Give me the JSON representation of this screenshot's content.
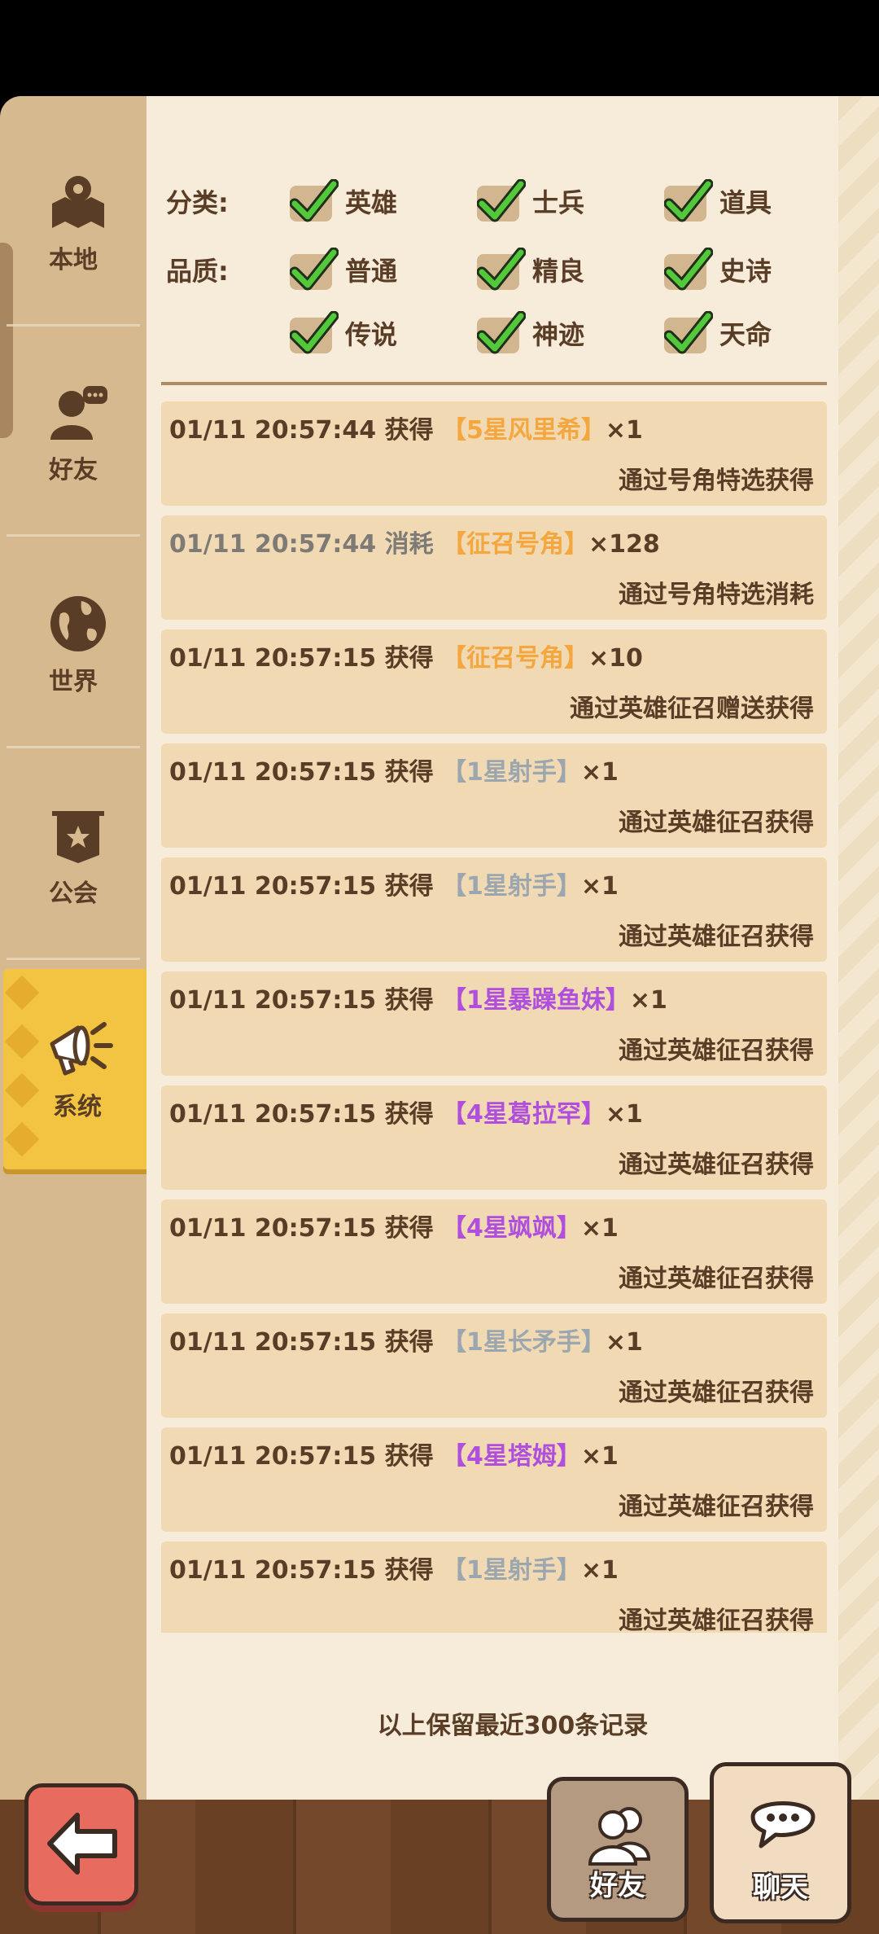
{
  "sidebar": {
    "items": [
      {
        "label": "本地",
        "icon": "map-pin-icon"
      },
      {
        "label": "好友",
        "icon": "friend-chat-icon"
      },
      {
        "label": "世界",
        "icon": "globe-icon"
      },
      {
        "label": "公会",
        "icon": "guild-banner-icon"
      },
      {
        "label": "系统",
        "icon": "megaphone-icon",
        "active": true
      }
    ]
  },
  "filters": {
    "category_label": "分类:",
    "quality_label": "品质:",
    "categories": [
      {
        "label": "英雄",
        "checked": true
      },
      {
        "label": "士兵",
        "checked": true
      },
      {
        "label": "道具",
        "checked": true
      }
    ],
    "qualities": [
      {
        "label": "普通",
        "checked": true
      },
      {
        "label": "精良",
        "checked": true
      },
      {
        "label": "史诗",
        "checked": true
      },
      {
        "label": "传说",
        "checked": true
      },
      {
        "label": "神迹",
        "checked": true
      },
      {
        "label": "天命",
        "checked": true
      }
    ]
  },
  "logs": [
    {
      "time": "01/11 20:57:44",
      "action": "获得",
      "item": "【5星风里希】",
      "qty": "×1",
      "source": "通过号角特选获得",
      "quality_color": "#f4a73f"
    },
    {
      "time": "01/11 20:57:44",
      "action": "消耗",
      "item": "【征召号角】",
      "qty": "×128",
      "source": "通过号角特选消耗",
      "quality_color": "#f4a73f",
      "muted": true
    },
    {
      "time": "01/11 20:57:15",
      "action": "获得",
      "item": "【征召号角】",
      "qty": "×10",
      "source": "通过英雄征召赠送获得",
      "quality_color": "#f4a73f"
    },
    {
      "time": "01/11 20:57:15",
      "action": "获得",
      "item": "【1星射手】",
      "qty": "×1",
      "source": "通过英雄征召获得",
      "quality_color": "#9ca6ae"
    },
    {
      "time": "01/11 20:57:15",
      "action": "获得",
      "item": "【1星射手】",
      "qty": "×1",
      "source": "通过英雄征召获得",
      "quality_color": "#9ca6ae"
    },
    {
      "time": "01/11 20:57:15",
      "action": "获得",
      "item": "【1星暴躁鱼妹】",
      "qty": "×1",
      "source": "通过英雄征召获得",
      "quality_color": "#b04fdc"
    },
    {
      "time": "01/11 20:57:15",
      "action": "获得",
      "item": "【4星葛拉罕】",
      "qty": "×1",
      "source": "通过英雄征召获得",
      "quality_color": "#b04fdc"
    },
    {
      "time": "01/11 20:57:15",
      "action": "获得",
      "item": "【4星飒飒】",
      "qty": "×1",
      "source": "通过英雄征召获得",
      "quality_color": "#b04fdc"
    },
    {
      "time": "01/11 20:57:15",
      "action": "获得",
      "item": "【1星长矛手】",
      "qty": "×1",
      "source": "通过英雄征召获得",
      "quality_color": "#9ca6ae"
    },
    {
      "time": "01/11 20:57:15",
      "action": "获得",
      "item": "【4星塔姆】",
      "qty": "×1",
      "source": "通过英雄征召获得",
      "quality_color": "#b04fdc"
    },
    {
      "time": "01/11 20:57:15",
      "action": "获得",
      "item": "【1星射手】",
      "qty": "×1",
      "source": "通过英雄征召获得",
      "quality_color": "#9ca6ae"
    }
  ],
  "footer_note": "以上保留最近300条记录",
  "bottom": {
    "back_icon": "arrow-left-icon",
    "friends_label": "好友",
    "chat_label": "聊天"
  }
}
